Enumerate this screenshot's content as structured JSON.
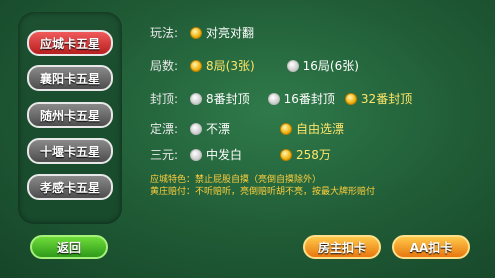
{
  "sidebar": {
    "items": [
      {
        "label": "应城卡五星",
        "active": true
      },
      {
        "label": "襄阳卡五星",
        "active": false
      },
      {
        "label": "随州卡五星",
        "active": false
      },
      {
        "label": "十堰卡五星",
        "active": false
      },
      {
        "label": "孝感卡五星",
        "active": false
      }
    ]
  },
  "options": {
    "play": {
      "label": "玩法:",
      "choices": [
        {
          "text": "对亮对翻",
          "selected": true
        }
      ]
    },
    "rounds": {
      "label": "局数:",
      "choices": [
        {
          "text": "8局(3张)",
          "selected": true
        },
        {
          "text": "16局(6张)",
          "selected": false
        }
      ]
    },
    "cap": {
      "label": "封顶:",
      "choices": [
        {
          "text": "8番封顶",
          "selected": false
        },
        {
          "text": "16番封顶",
          "selected": false
        },
        {
          "text": "32番封顶",
          "selected": true
        }
      ]
    },
    "drift": {
      "label": "定漂:",
      "choices": [
        {
          "text": "不漂",
          "selected": false
        },
        {
          "text": "自由选漂",
          "selected": true
        }
      ]
    },
    "three": {
      "label": "三元:",
      "choices": [
        {
          "text": "中发白",
          "selected": false
        },
        {
          "text": "258万",
          "selected": true
        }
      ]
    }
  },
  "notes": {
    "line1": "应城特色：禁止屁股自摸（亮倒自摸除外）",
    "line2": "黄庄赔付：不听赔听，亮倒赔听胡不亮，按最大牌形赔付"
  },
  "buttons": {
    "back": "返回",
    "host_pay": "房主扣卡",
    "aa_pay": "AA扣卡"
  },
  "colors": {
    "selected_text": "#ffe66a",
    "note_text": "#ffcf3f",
    "active_tab": "#d83a3a"
  }
}
